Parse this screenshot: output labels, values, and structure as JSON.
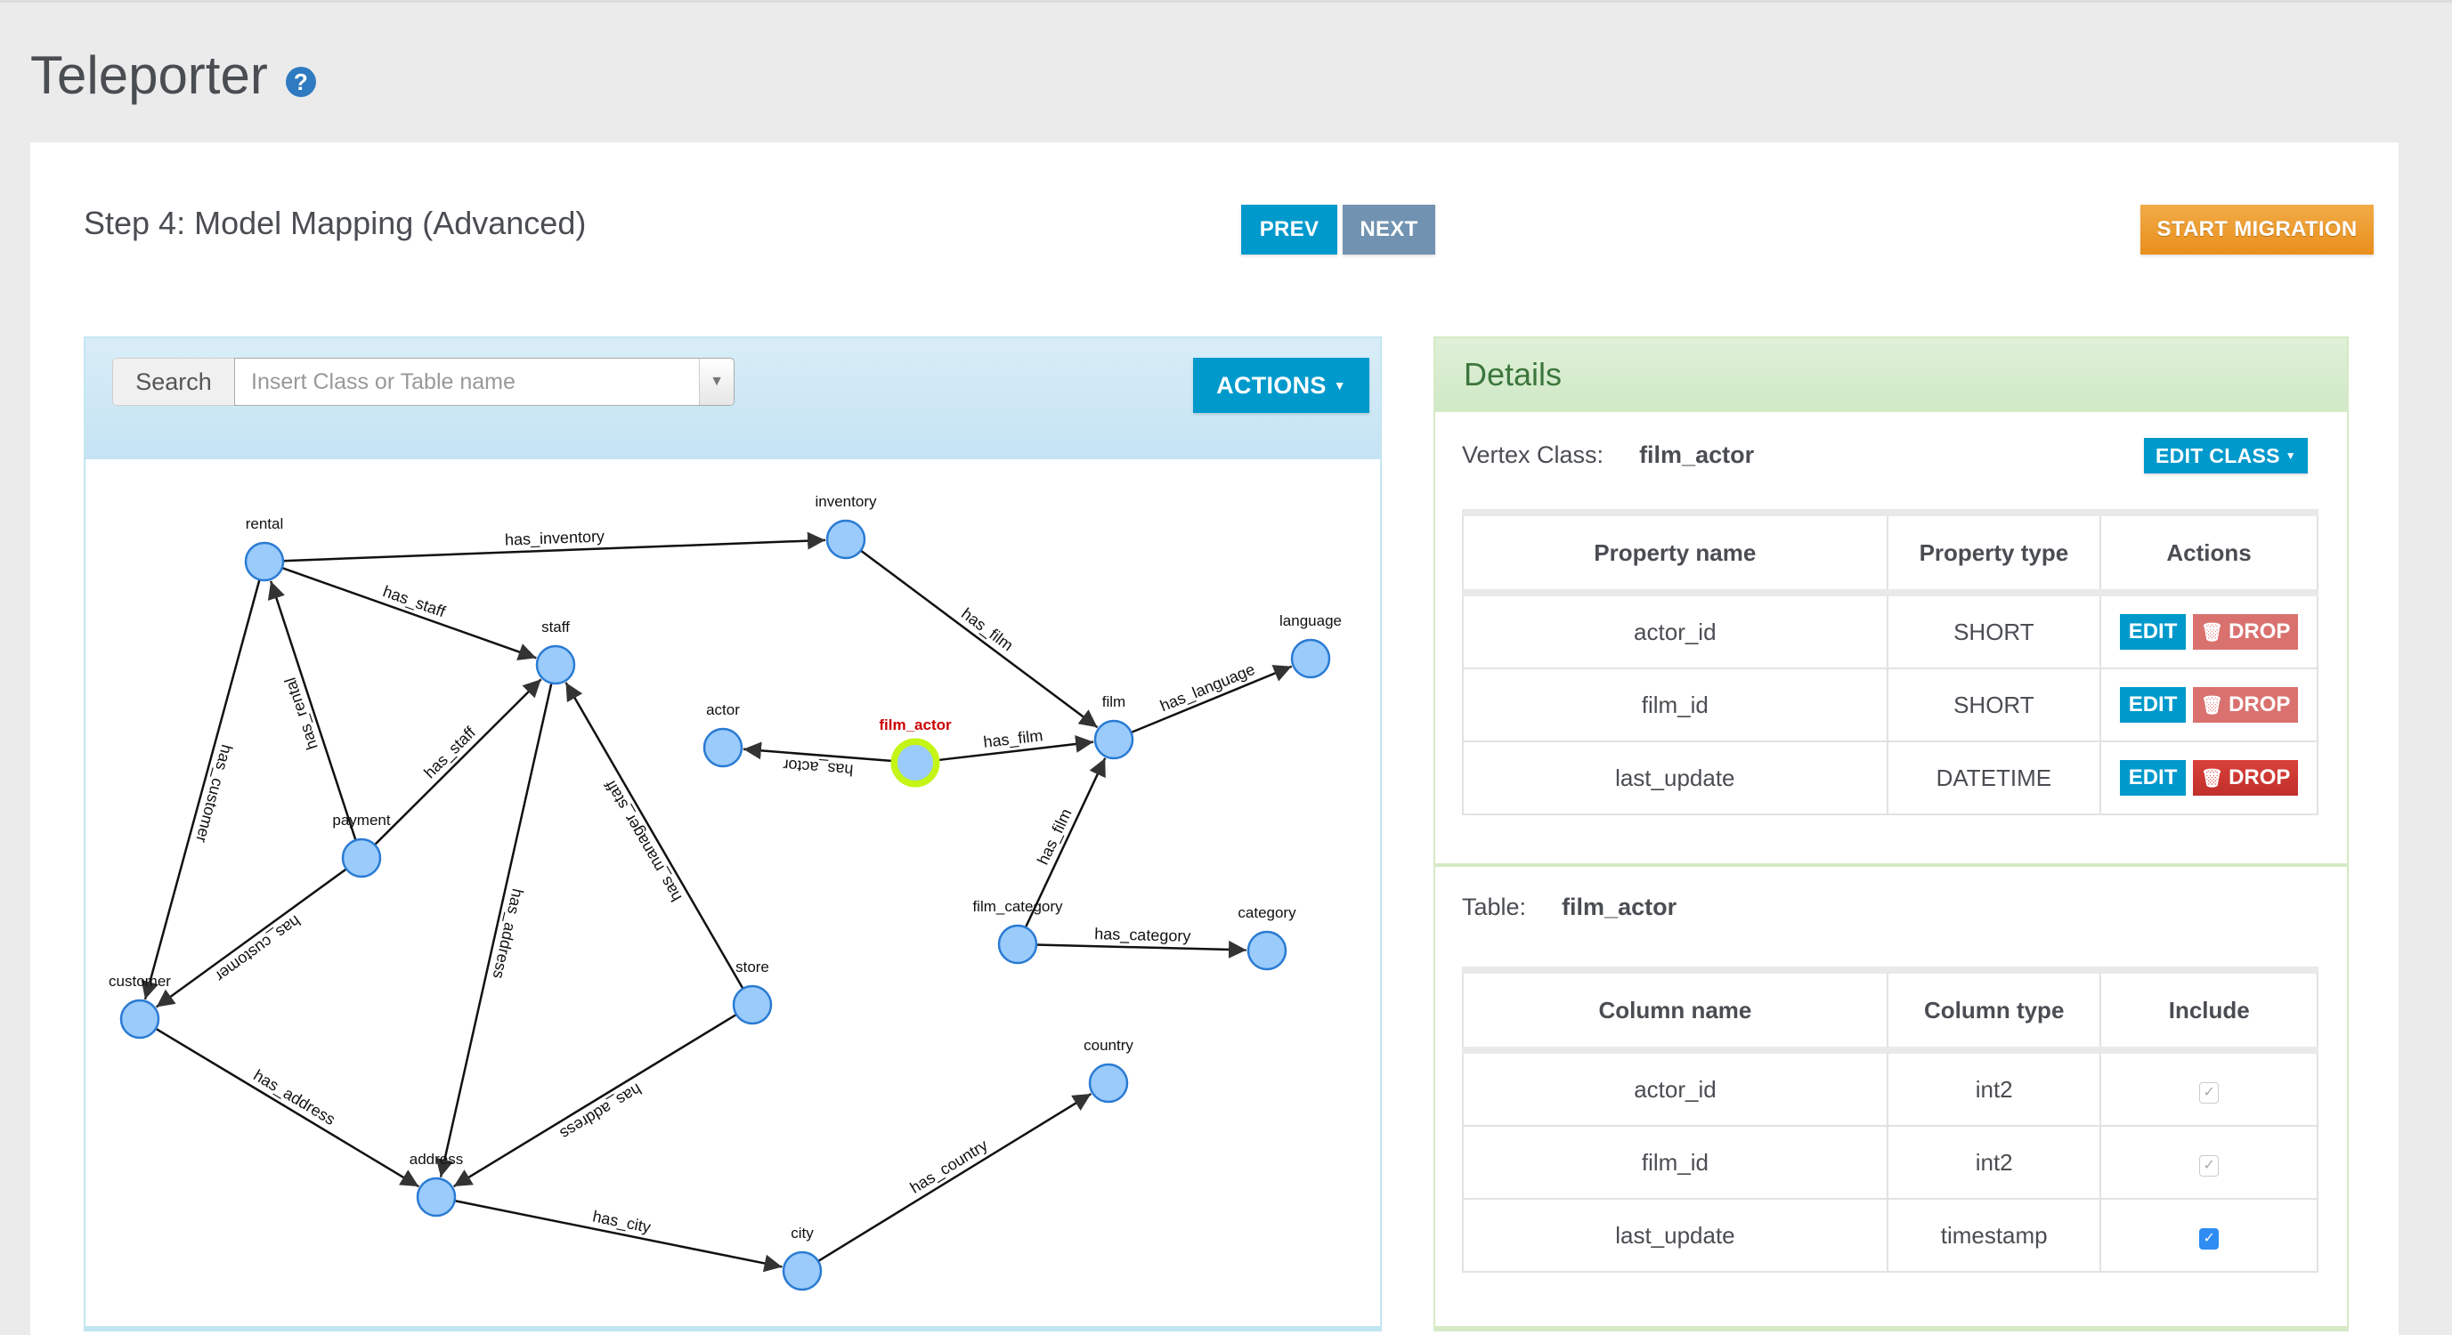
{
  "app": {
    "title": "Teleporter",
    "help_icon": "question-circle-icon"
  },
  "wizard": {
    "step_title": "Step 4: Model Mapping (Advanced)",
    "prev_label": "PREV",
    "next_label": "NEXT",
    "start_label": "START MIGRATION"
  },
  "graph_panel": {
    "search_label": "Search",
    "search_placeholder": "Insert Class or Table name",
    "search_value": "",
    "actions_label": "ACTIONS",
    "selected_node": "film_actor",
    "nodes": [
      {
        "id": "rental",
        "label": "rental"
      },
      {
        "id": "inventory",
        "label": "inventory"
      },
      {
        "id": "staff",
        "label": "staff"
      },
      {
        "id": "language",
        "label": "language"
      },
      {
        "id": "actor",
        "label": "actor"
      },
      {
        "id": "film_actor",
        "label": "film_actor"
      },
      {
        "id": "film",
        "label": "film"
      },
      {
        "id": "payment",
        "label": "payment"
      },
      {
        "id": "film_category",
        "label": "film_category"
      },
      {
        "id": "category",
        "label": "category"
      },
      {
        "id": "customer",
        "label": "customer"
      },
      {
        "id": "store",
        "label": "store"
      },
      {
        "id": "country",
        "label": "country"
      },
      {
        "id": "address",
        "label": "address"
      },
      {
        "id": "city",
        "label": "city"
      }
    ],
    "edges": [
      {
        "from": "rental",
        "to": "inventory",
        "label": "has_inventory"
      },
      {
        "from": "rental",
        "to": "staff",
        "label": "has_staff"
      },
      {
        "from": "rental",
        "to": "customer",
        "label": "has_customer"
      },
      {
        "from": "payment",
        "to": "rental",
        "label": "has_rental"
      },
      {
        "from": "payment",
        "to": "staff",
        "label": "has_staff"
      },
      {
        "from": "payment",
        "to": "customer",
        "label": "has_customer"
      },
      {
        "from": "staff",
        "to": "address",
        "label": "has_address"
      },
      {
        "from": "store",
        "to": "staff",
        "label": "has_manager_staff"
      },
      {
        "from": "store",
        "to": "address",
        "label": "has_address"
      },
      {
        "from": "customer",
        "to": "address",
        "label": "has_address"
      },
      {
        "from": "inventory",
        "to": "film",
        "label": "has_film"
      },
      {
        "from": "film",
        "to": "language",
        "label": "has_language"
      },
      {
        "from": "film_actor",
        "to": "actor",
        "label": "has_actor"
      },
      {
        "from": "film_actor",
        "to": "film",
        "label": "has_film"
      },
      {
        "from": "film_category",
        "to": "film",
        "label": "has_film"
      },
      {
        "from": "film_category",
        "to": "category",
        "label": "has_category"
      },
      {
        "from": "address",
        "to": "city",
        "label": "has_city"
      },
      {
        "from": "city",
        "to": "country",
        "label": "has_country"
      }
    ]
  },
  "details": {
    "title": "Details",
    "vertex_label": "Vertex Class:",
    "vertex_value": "film_actor",
    "edit_class_label": "EDIT CLASS",
    "properties": {
      "headers": [
        "Property name",
        "Property type",
        "Actions"
      ],
      "rows": [
        {
          "name": "actor_id",
          "type": "SHORT",
          "edit": "EDIT",
          "drop": "DROP"
        },
        {
          "name": "film_id",
          "type": "SHORT",
          "edit": "EDIT",
          "drop": "DROP"
        },
        {
          "name": "last_update",
          "type": "DATETIME",
          "edit": "EDIT",
          "drop": "DROP"
        }
      ]
    },
    "table_label": "Table:",
    "table_value": "film_actor",
    "columns": {
      "headers": [
        "Column name",
        "Column type",
        "Include"
      ],
      "rows": [
        {
          "name": "actor_id",
          "type": "int2",
          "include": true,
          "disabled": true
        },
        {
          "name": "film_id",
          "type": "int2",
          "include": true,
          "disabled": true
        },
        {
          "name": "last_update",
          "type": "timestamp",
          "include": true,
          "disabled": false
        }
      ]
    }
  },
  "colors": {
    "primary": "#0099cc",
    "next": "#7193b1",
    "start": "#ec9a2c",
    "node_fill": "#9acbfb",
    "node_stroke": "#2a7bd3",
    "selected_ring": "#c4f516",
    "selected_label": "#cc0000",
    "drop": "#d9726f",
    "drop_active": "#cf3a35"
  }
}
